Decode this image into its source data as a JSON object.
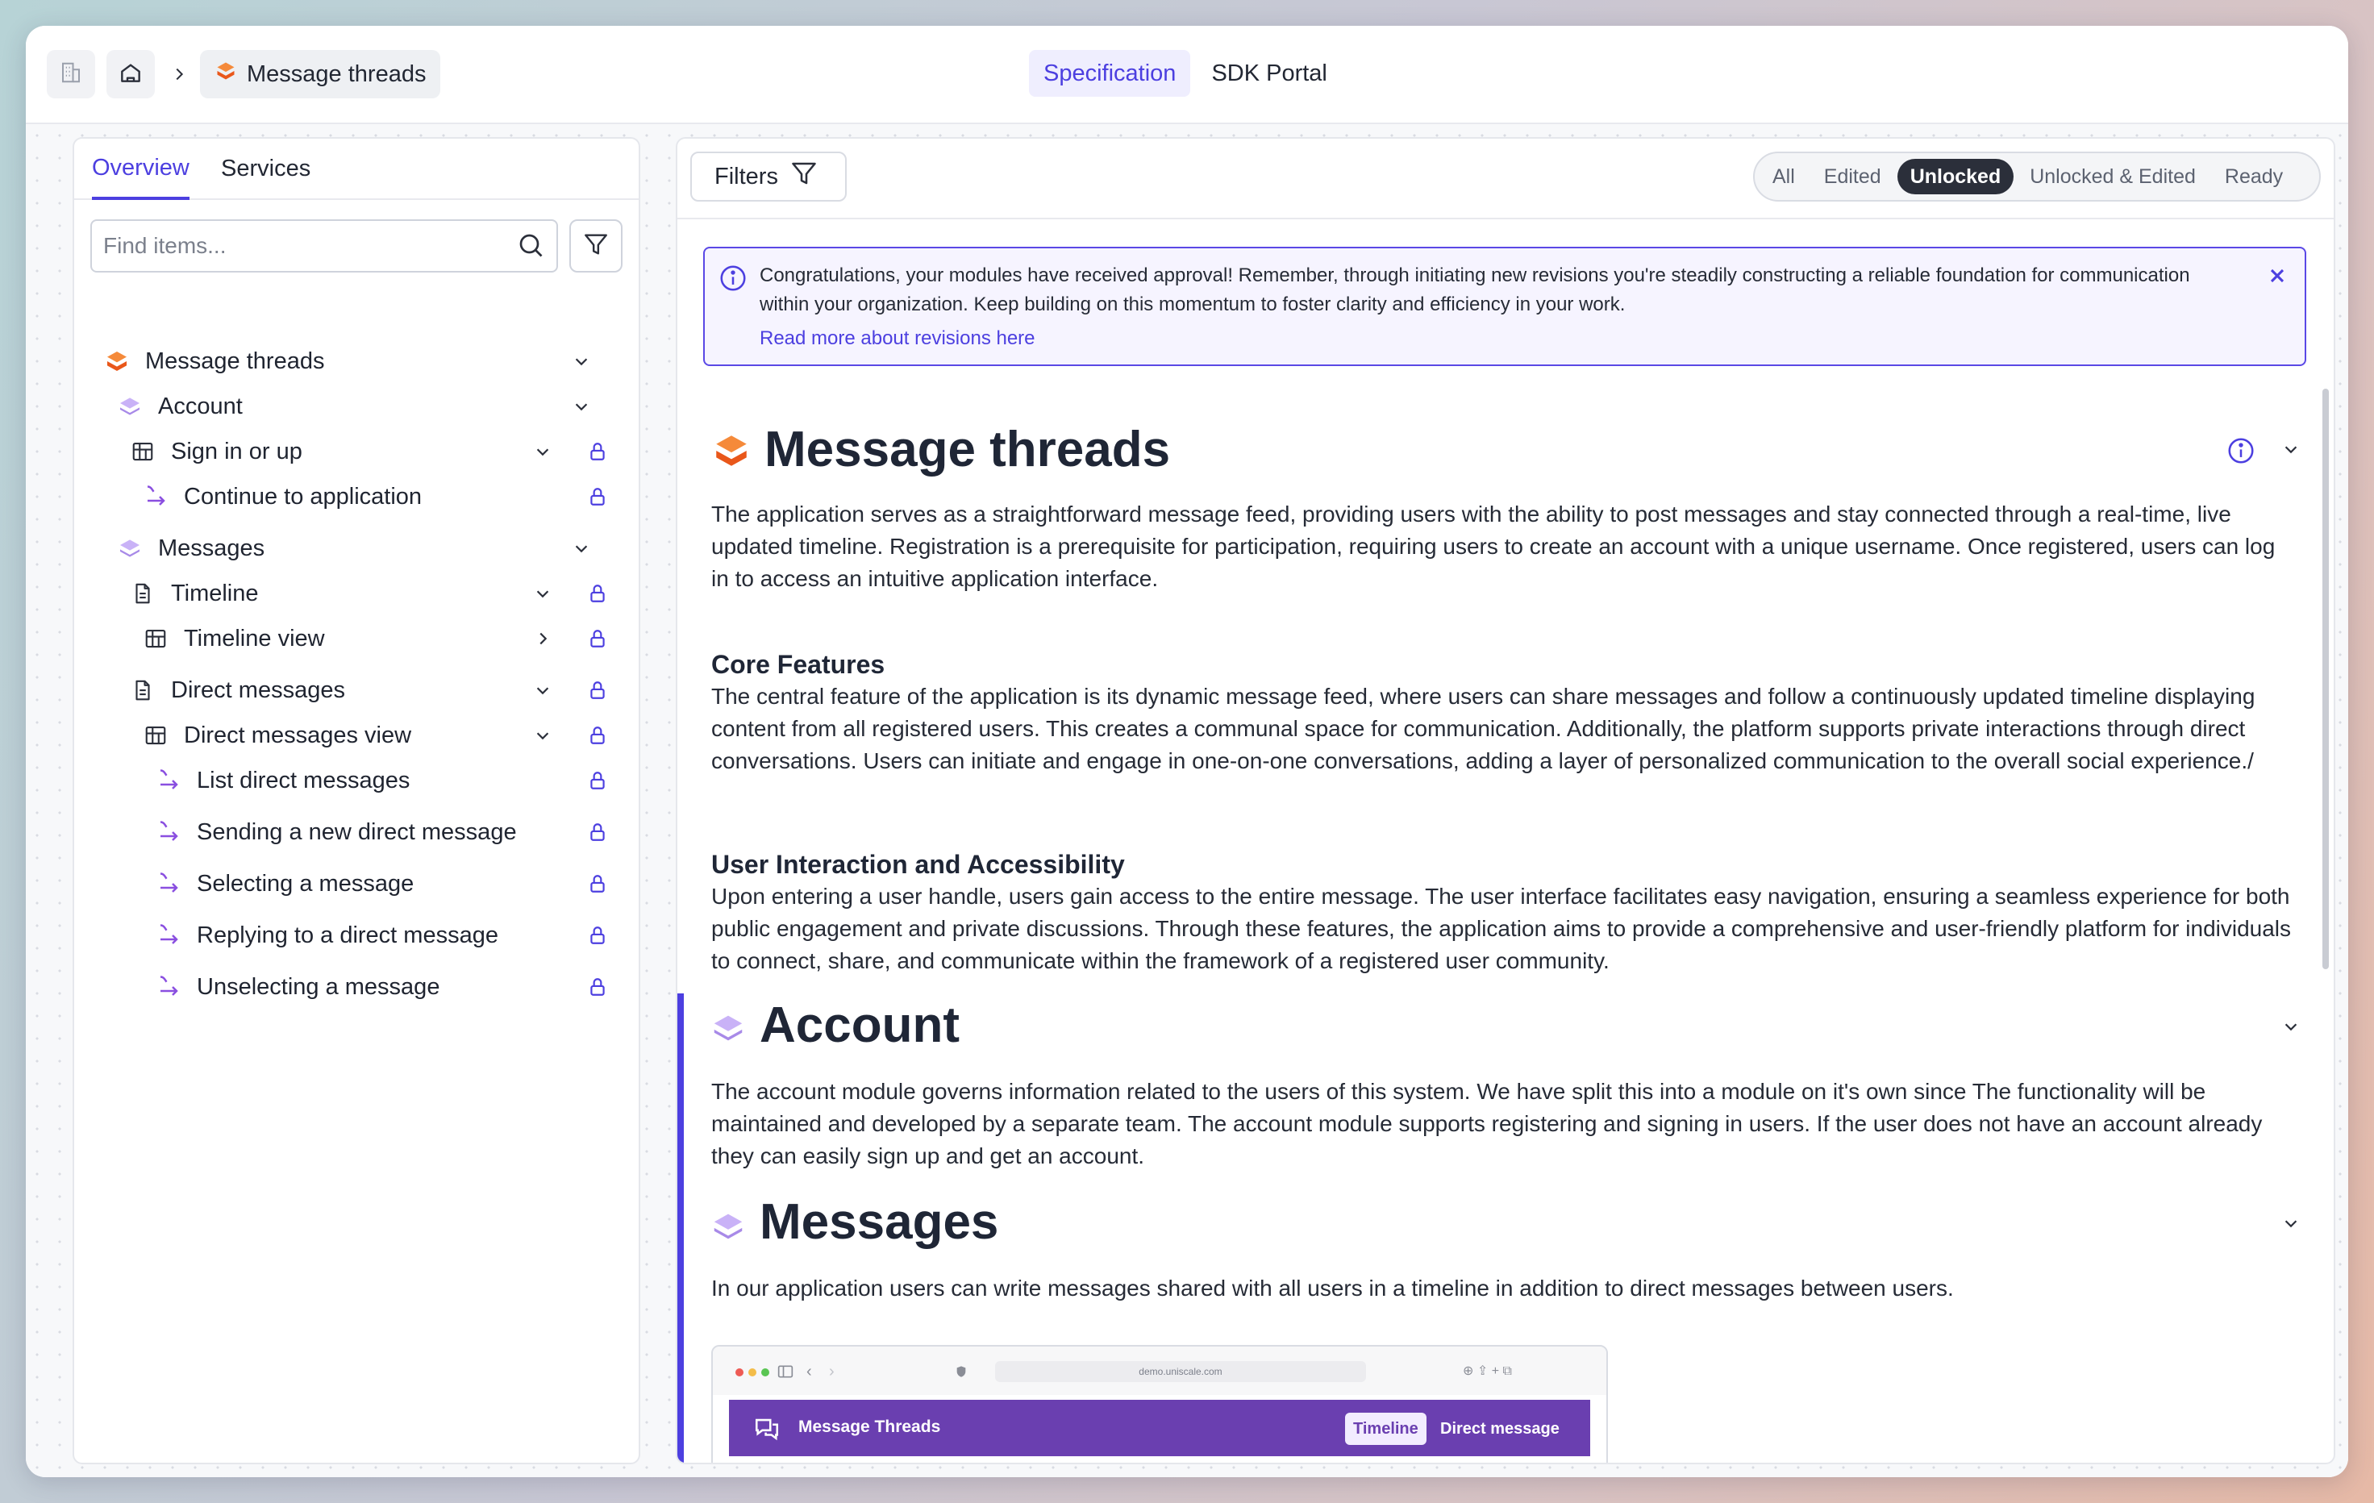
{
  "topbar": {
    "breadcrumb_current": "Message threads",
    "tabs": [
      {
        "label": "Specification",
        "active": true
      },
      {
        "label": "SDK Portal",
        "active": false
      }
    ]
  },
  "sidebar": {
    "tabs": [
      {
        "label": "Overview",
        "active": true
      },
      {
        "label": "Services",
        "active": false
      }
    ],
    "search": {
      "placeholder": "Find items...",
      "value": ""
    },
    "tree": [
      {
        "label": "Message threads",
        "icon": "module-orange-icon",
        "chevron": "down",
        "locked": false
      },
      {
        "label": "Account",
        "icon": "module-purple-icon",
        "chevron": "down",
        "locked": false
      },
      {
        "label": "Sign in or up",
        "icon": "view-grid-icon",
        "chevron": "down",
        "locked": true
      },
      {
        "label": "Continue to application",
        "icon": "flow-arrow-icon",
        "chevron": "",
        "locked": true
      },
      {
        "label": "Messages",
        "icon": "module-purple-icon",
        "chevron": "down",
        "locked": false
      },
      {
        "label": "Timeline",
        "icon": "document-icon",
        "chevron": "down",
        "locked": true
      },
      {
        "label": "Timeline view",
        "icon": "view-grid-icon",
        "chevron": "right",
        "locked": true
      },
      {
        "label": "Direct messages",
        "icon": "document-icon",
        "chevron": "down",
        "locked": true
      },
      {
        "label": "Direct messages view",
        "icon": "view-grid-icon",
        "chevron": "down",
        "locked": true
      },
      {
        "label": "List direct messages",
        "icon": "flow-arrow-icon",
        "chevron": "",
        "locked": true
      },
      {
        "label": "Sending a new direct message",
        "icon": "flow-arrow-icon",
        "chevron": "",
        "locked": true
      },
      {
        "label": "Selecting a message",
        "icon": "flow-arrow-icon",
        "chevron": "",
        "locked": true
      },
      {
        "label": "Replying to a direct message",
        "icon": "flow-arrow-icon",
        "chevron": "",
        "locked": true
      },
      {
        "label": "Unselecting a message",
        "icon": "flow-arrow-icon",
        "chevron": "",
        "locked": true
      }
    ]
  },
  "main": {
    "filters_label": "Filters",
    "status_filters": [
      {
        "label": "All",
        "active": false
      },
      {
        "label": "Edited",
        "active": false
      },
      {
        "label": "Unlocked",
        "active": true
      },
      {
        "label": "Unlocked & Edited",
        "active": false
      },
      {
        "label": "Ready",
        "active": false
      }
    ],
    "alert": {
      "text": "Congratulations, your modules have received approval! Remember, through initiating new revisions you're steadily constructing a reliable foundation for communication within your organization. Keep building on this momentum to foster clarity and efficiency in your work.",
      "link": "Read more about revisions here"
    },
    "sections": {
      "message_threads": {
        "title": "Message threads",
        "intro": "The application serves as a straightforward message feed, providing users with the ability to post messages and stay connected through a real-time, live updated timeline. Registration is a prerequisite for participation, requiring users to create an account with a unique username. Once registered, users can log in to access an intuitive application interface.",
        "core_heading": "Core Features",
        "core_text": "The central feature of the application is its dynamic message feed, where users can share messages and follow a continuously updated timeline displaying content from all registered users. This creates a communal space for communication. Additionally, the platform supports private interactions through direct conversations. Users can initiate and engage in one-on-one conversations, adding a layer of personalized communication to the overall social experience./",
        "ux_heading": "User Interaction and Accessibility",
        "ux_text": "Upon entering a user handle, users gain access to the entire message. The user interface facilitates easy navigation, ensuring a seamless experience for both public engagement and private discussions. Through these features, the application aims to provide a comprehensive and user-friendly platform for individuals to connect, share, and communicate within the framework of a registered user community."
      },
      "account": {
        "title": "Account",
        "text": "The account module governs information related to the users of this system. We have split this into a module on it's own since The functionality will be maintained and developed by a separate team. The account module supports registering and signing in users. If the user does not have an account already they can easily sign up and get an account."
      },
      "messages": {
        "title": "Messages",
        "text": "In our application users can write messages shared with all users in a timeline in addition to direct messages between users."
      }
    },
    "preview": {
      "url": "demo.uniscale.com",
      "app_title": "Message Threads",
      "tabs": [
        {
          "label": "Timeline",
          "active": true
        },
        {
          "label": "Direct message",
          "active": false
        }
      ]
    }
  },
  "colors": {
    "accent": "#4c3fe0",
    "module_orange": "#f26a1b",
    "module_purple": "#b79cf2",
    "flow_arrow": "#8a4fe0",
    "preview_app": "#6a3fb0"
  }
}
